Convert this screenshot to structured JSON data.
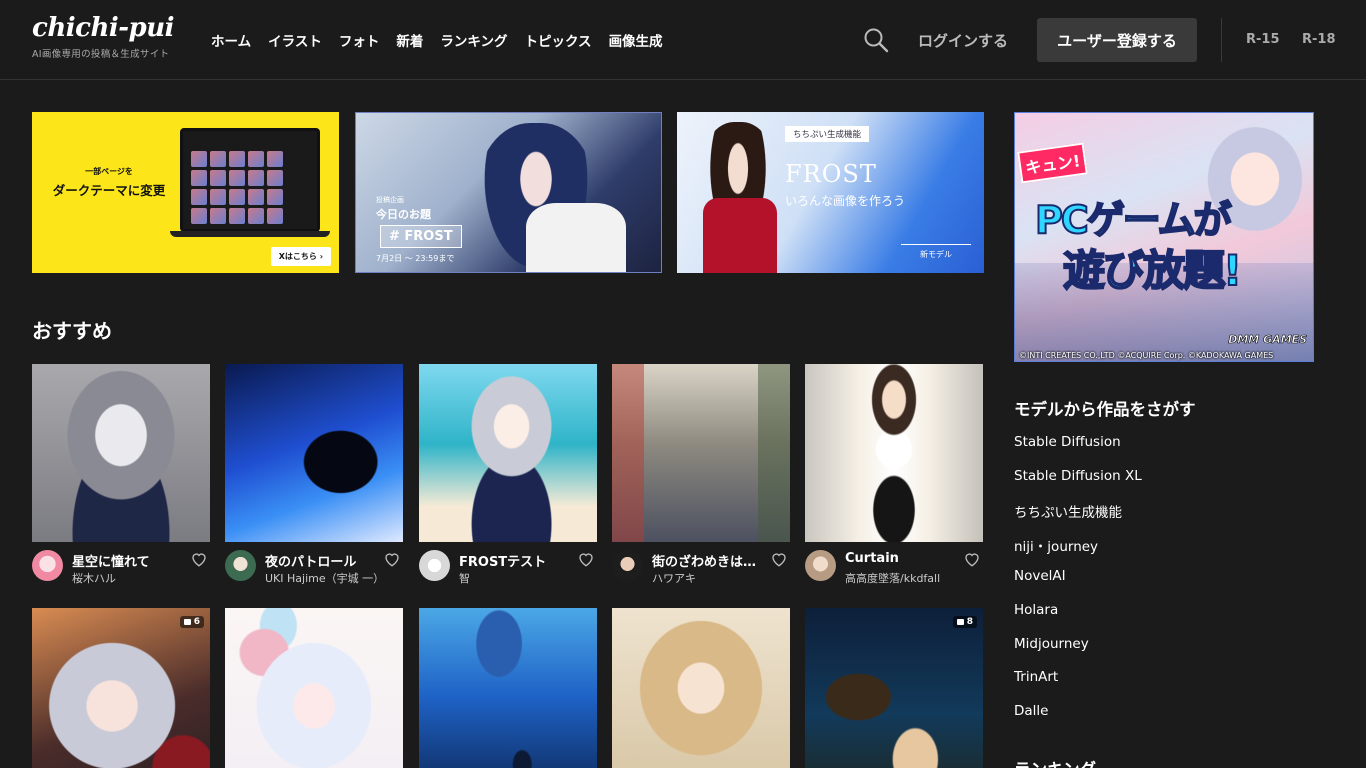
{
  "header": {
    "logo": "chichi-pui",
    "tagline": "AI画像専用の投稿＆生成サイト",
    "nav": [
      "ホーム",
      "イラスト",
      "フォト",
      "新着",
      "ランキング",
      "トピックス",
      "画像生成"
    ],
    "login": "ログインする",
    "register": "ユーザー登録する",
    "ratings": [
      "R-15",
      "R-18"
    ]
  },
  "banners": {
    "dark_theme": {
      "small": "一部ページを",
      "big": "ダークテーマに変更",
      "link": "Xはこちら ›"
    },
    "topic": {
      "small": "投稿企画",
      "title": "今日のお題",
      "tag": "# FROST",
      "date": "7月2日 〜 23:59まで"
    },
    "model": {
      "small": "ちちぷい生成機能",
      "title": "FROST",
      "sub": "いろんな画像を作ろう",
      "new": "新モデル"
    }
  },
  "section": {
    "title": "おすすめ"
  },
  "cards_row1": [
    {
      "title": "星空に憧れて",
      "author": "桜木ハル"
    },
    {
      "title": "夜のパトロール",
      "author": "UKI Hajime（宇城 一）"
    },
    {
      "title": "FROSTテスト",
      "author": "智"
    },
    {
      "title": "街のざわめきは…",
      "author": "ハワアキ"
    },
    {
      "title": "Curtain",
      "author": "高高度墜落/kkdfall"
    }
  ],
  "cards_row2": [
    {
      "count": "6"
    },
    {
      "count": ""
    },
    {
      "count": ""
    },
    {
      "count": ""
    },
    {
      "count": "8"
    }
  ],
  "ad": {
    "kyun": "キュン!",
    "line1": "PCゲームが",
    "line2": "遊び放題!",
    "brand": "DMM GAMES",
    "copyright": "©INTI CREATES CO.,LTD ©ACQUIRE Corp. ©KADOKAWA GAMES"
  },
  "sidebar": {
    "models_title": "モデルから作品をさがす",
    "models": [
      "Stable Diffusion",
      "Stable Diffusion XL",
      "ちちぷい生成機能",
      "niji・journey",
      "NovelAI",
      "Holara",
      "Midjourney",
      "TrinArt",
      "Dalle"
    ],
    "ranking_title": "ランキング"
  },
  "colors": {
    "background": "#1b1b1b",
    "accent_border": "#5b7fd8",
    "banner_yellow": "#fce61a"
  },
  "icons": {
    "search": "search-icon",
    "heart": "heart-icon",
    "count": "image-count-icon"
  }
}
